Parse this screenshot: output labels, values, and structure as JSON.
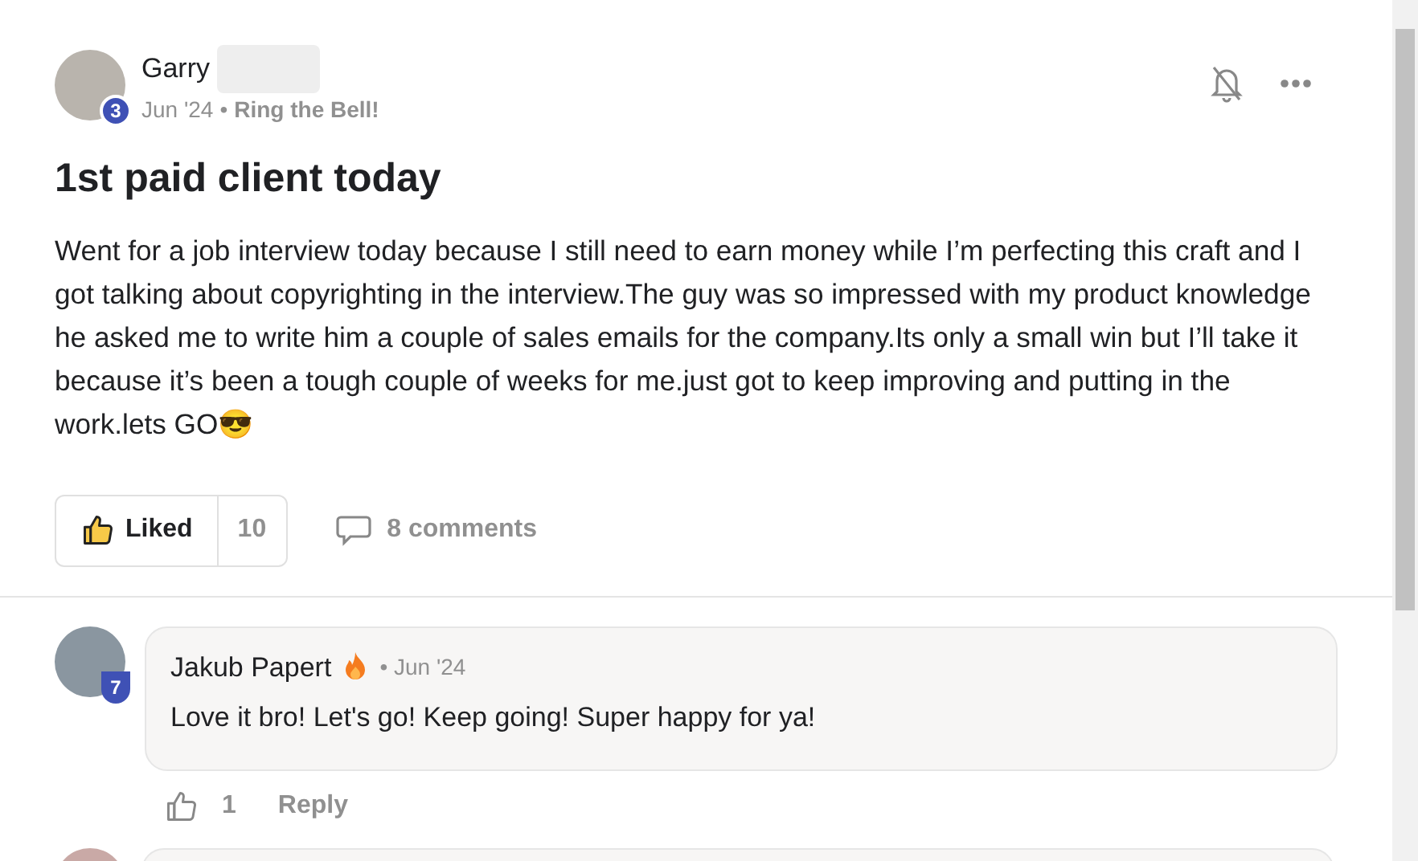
{
  "post": {
    "author": "Garry",
    "level_badge": "3",
    "date": "Jun '24",
    "separator": "•",
    "category": "Ring the Bell!",
    "title": "1st paid client today",
    "body": "Went for a job interview today because I still need to earn money while I’m perfecting this craft and I got talking about copyrighting in the interview.The guy was so impressed with my product knowledge he asked me to write him a couple of sales emails for the company.Its only a small win but I’ll take it because it’s been a tough couple of weeks for me.just got to keep improving and putting in the work.lets GO😎",
    "like_label": "Liked",
    "liked": true,
    "like_count": "10",
    "comments_label": "8 comments"
  },
  "comments": [
    {
      "author": "Jakub Papert",
      "level_badge": "7",
      "date": "• Jun '24",
      "text": "Love it bro! Let's go! Keep going! Super happy for ya!",
      "liked": false,
      "like_count": "1",
      "reply_label": "Reply"
    }
  ]
}
